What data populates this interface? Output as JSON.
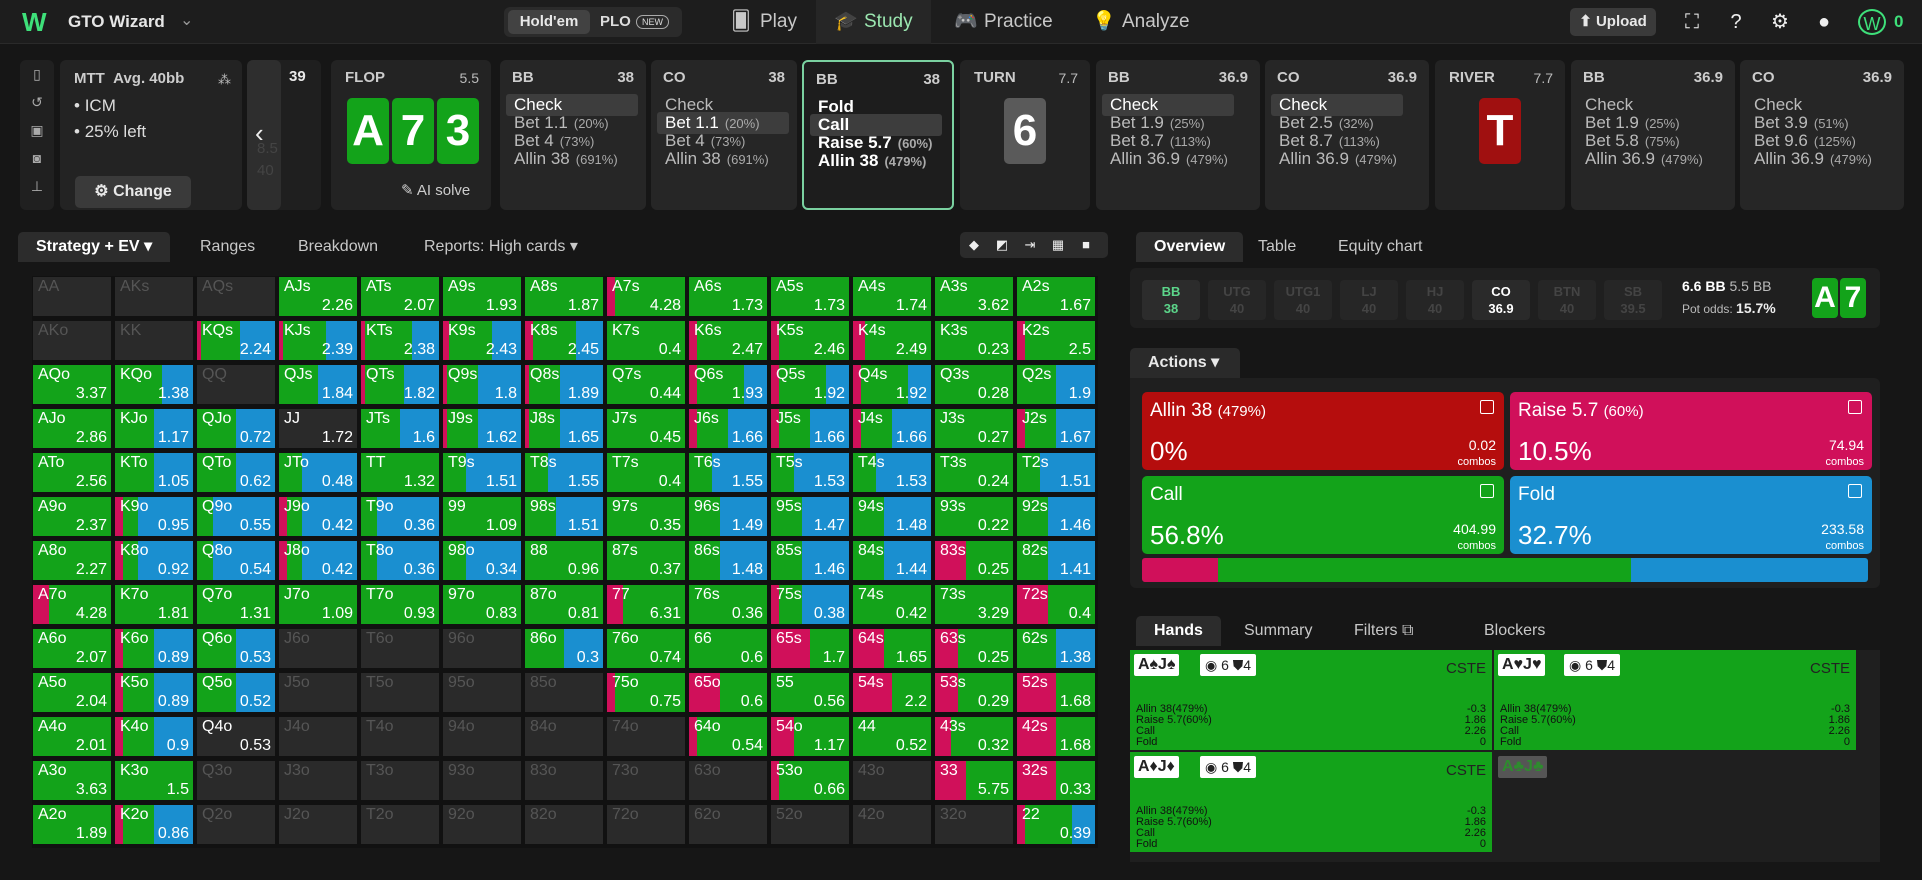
{
  "app": {
    "name": "GTO Wizard"
  },
  "game_toggle": {
    "on": "Hold'em",
    "off": "PLO",
    "badge": "NEW"
  },
  "nav": [
    {
      "label": "Play"
    },
    {
      "label": "Study"
    },
    {
      "label": "Practice"
    },
    {
      "label": "Analyze"
    }
  ],
  "toolbar": {
    "upload": "Upload",
    "coins": "0"
  },
  "format": {
    "title": "MTT",
    "avg": "Avg. 40bb",
    "items": [
      "ICM",
      "25% left"
    ],
    "change": "Change"
  },
  "slider": {
    "top": "39",
    "mid": "8.5",
    "bot": "40"
  },
  "flop": {
    "name": "FLOP",
    "pot": "5.5",
    "cards": [
      "A",
      "7",
      "3"
    ],
    "ai": "AI solve"
  },
  "turn": {
    "name": "TURN",
    "pot": "7.7",
    "card": "6"
  },
  "river": {
    "name": "RIVER",
    "pot": "7.7",
    "card": "T"
  },
  "action_cols": [
    {
      "pos": "BB",
      "stack": "38",
      "lines": [
        {
          "t": "Check",
          "p": ""
        },
        {
          "t": "Bet 1.1",
          "p": "(20%)"
        },
        {
          "t": "Bet 4",
          "p": "(73%)"
        },
        {
          "t": "Allin 38",
          "p": "(691%)"
        }
      ]
    },
    {
      "pos": "CO",
      "stack": "38",
      "lines": [
        {
          "t": "Check",
          "p": ""
        },
        {
          "t": "Bet 1.1",
          "p": "(20%)"
        },
        {
          "t": "Bet 4",
          "p": "(73%)"
        },
        {
          "t": "Allin 38",
          "p": "(691%)"
        }
      ]
    },
    {
      "pos": "BB",
      "stack": "38",
      "lines": [
        {
          "t": "Fold",
          "p": ""
        },
        {
          "t": "Call",
          "p": ""
        },
        {
          "t": "Raise 5.7",
          "p": "(60%)"
        },
        {
          "t": "Allin 38",
          "p": "(479%)"
        }
      ]
    },
    {
      "pos": "BB",
      "stack": "36.9",
      "lines": [
        {
          "t": "Check",
          "p": ""
        },
        {
          "t": "Bet 1.9",
          "p": "(25%)"
        },
        {
          "t": "Bet 8.7",
          "p": "(113%)"
        },
        {
          "t": "Allin 36.9",
          "p": "(479%)"
        }
      ]
    },
    {
      "pos": "CO",
      "stack": "36.9",
      "lines": [
        {
          "t": "Check",
          "p": ""
        },
        {
          "t": "Bet 2.5",
          "p": "(32%)"
        },
        {
          "t": "Bet 8.7",
          "p": "(113%)"
        },
        {
          "t": "Allin 36.9",
          "p": "(479%)"
        }
      ]
    },
    {
      "pos": "BB",
      "stack": "36.9",
      "lines": [
        {
          "t": "Check",
          "p": ""
        },
        {
          "t": "Bet 1.9",
          "p": "(25%)"
        },
        {
          "t": "Bet 5.8",
          "p": "(75%)"
        },
        {
          "t": "Allin 36.9",
          "p": "(479%)"
        }
      ]
    },
    {
      "pos": "CO",
      "stack": "36.9",
      "lines": [
        {
          "t": "Check",
          "p": ""
        },
        {
          "t": "Bet 3.9",
          "p": "(51%)"
        },
        {
          "t": "Bet 9.6",
          "p": "(125%)"
        },
        {
          "t": "Allin 36.9",
          "p": "(479%)"
        }
      ]
    }
  ],
  "left_tabs": [
    "Strategy + EV",
    "Ranges",
    "Breakdown",
    "Reports: High cards"
  ],
  "right_tabs": [
    "Overview",
    "Table",
    "Equity chart"
  ],
  "players": [
    {
      "pos": "BB",
      "stack": "38"
    },
    {
      "pos": "UTG",
      "stack": "40"
    },
    {
      "pos": "UTG1",
      "stack": "40"
    },
    {
      "pos": "LJ",
      "stack": "40"
    },
    {
      "pos": "HJ",
      "stack": "40"
    },
    {
      "pos": "CO",
      "stack": "36.9"
    },
    {
      "pos": "BTN",
      "stack": "40"
    },
    {
      "pos": "SB",
      "stack": "39.5"
    }
  ],
  "pot_info": {
    "pot": "6.6 BB",
    "call": "5.5 BB",
    "odds_label": "Pot odds:",
    "odds": "15.7%"
  },
  "hero_cards": [
    "A",
    "7"
  ],
  "actions_label": "Actions",
  "actions": [
    {
      "name": "Allin 38",
      "size": "(479%)",
      "pct": "0%",
      "combos": "0.02",
      "color": "#b50d0d"
    },
    {
      "name": "Raise 5.7",
      "size": "(60%)",
      "pct": "10.5%",
      "combos": "74.94",
      "color": "#d0105a"
    },
    {
      "name": "Call",
      "size": "",
      "pct": "56.8%",
      "combos": "404.99",
      "color": "#13a31a"
    },
    {
      "name": "Fold",
      "size": "",
      "pct": "32.7%",
      "combos": "233.58",
      "color": "#1a8fd0"
    }
  ],
  "combos_word": "combos",
  "freq": [
    0.105,
    0.568,
    0.327
  ],
  "hand_tabs": [
    "Hands",
    "Summary",
    "Filters",
    "Blockers"
  ],
  "hands": [
    {
      "cards": "A♠J♠",
      "b": "6",
      "c": "4",
      "tag": "CSTE",
      "rows": [
        [
          "Allin 38",
          "(479%)",
          "-0.3"
        ],
        [
          "Raise 5.7",
          "(60%)",
          "1.86"
        ],
        [
          "Call",
          "",
          "2.26"
        ],
        [
          "Fold",
          "",
          "0"
        ]
      ]
    },
    {
      "cards": "A♥J♥",
      "b": "6",
      "c": "4",
      "tag": "CSTE",
      "rows": [
        [
          "Allin 38",
          "(479%)",
          "-0.3"
        ],
        [
          "Raise 5.7",
          "(60%)",
          "1.86"
        ],
        [
          "Call",
          "",
          "2.26"
        ],
        [
          "Fold",
          "",
          "0"
        ]
      ]
    },
    {
      "cards": "A♦J♦",
      "b": "6",
      "c": "4",
      "tag": "CSTE",
      "rows": [
        [
          "Allin 38",
          "(479%)",
          "-0.3"
        ],
        [
          "Raise 5.7",
          "(60%)",
          "1.86"
        ],
        [
          "Call",
          "",
          "2.26"
        ],
        [
          "Fold",
          "",
          "0"
        ]
      ]
    },
    {
      "cards": "A♣J♣"
    }
  ],
  "grid": [
    [
      "AA|",
      "AKs|",
      "AQs|",
      "AJs|2.26|c",
      "ATs|2.07|c",
      "A9s|1.93|c",
      "A8s|1.87|c",
      "A7s|4.28|r10c",
      "A6s|1.73|c",
      "A5s|1.73|c",
      "A4s|1.74|c",
      "A3s|3.62|c",
      "A2s|1.67|c"
    ],
    [
      "AKo|",
      "KK|",
      "KQs|2.24|r5c50f",
      "KJs|2.39|r5c55f",
      "KTs|2.38|r5c60f",
      "K9s|2.43|r8c55f",
      "K8s|2.45|r10c55f",
      "K7s|0.4|c",
      "K6s|2.47|r10c",
      "K5s|2.46|r10c",
      "K4s|2.49|r15c",
      "K3s|0.23|c",
      "K2s|2.5|r10c"
    ],
    [
      "AQo|3.37|c",
      "KQo|1.38|c60f",
      "QQ|",
      "QJs|1.84|c50f",
      "QTs|1.82|r5c50f",
      "Q9s|1.8|r5c40f",
      "Q8s|1.89|r5c40f",
      "Q7s|0.44|c",
      "Q6s|1.93|r10c60f",
      "Q5s|1.92|r10c60f",
      "Q4s|1.92|r10c60f",
      "Q3s|0.28|c",
      "Q2s|1.9|c50f"
    ],
    [
      "AJo|2.86|c",
      "KJo|1.17|c50f",
      "QJo|0.72|c50f",
      "JJ|1.72|d",
      "JTs|1.6|c50f",
      "J9s|1.62|r5c40f",
      "J8s|1.65|r5c40f",
      "J7s|0.45|c",
      "J6s|1.66|r10c40f",
      "J5s|1.66|r10c40f",
      "J4s|1.66|r10c40f",
      "J3s|0.27|c",
      "J2s|1.67|r10c40f"
    ],
    [
      "ATo|2.56|c",
      "KTo|1.05|c50f",
      "QTo|0.62|c50f",
      "JTo|0.48|c30f",
      "TT|1.32|c",
      "T9s|1.51|c30f",
      "T8s|1.55|c30f",
      "T7s|0.4|c",
      "T6s|1.55|c30f",
      "T5s|1.53|c30f",
      "T4s|1.53|c30f",
      "T3s|0.24|c",
      "T2s|1.51|c30f"
    ],
    [
      "A9o|2.37|c",
      "K9o|0.95|r10c20f",
      "Q9o|0.55|c20f",
      "J9o|0.42|r10c20f",
      "T9o|0.36|c20f",
      "99|1.09|c",
      "98s|1.51|c40f",
      "97s|0.35|c",
      "96s|1.49|c40f",
      "95s|1.47|c40f",
      "94s|1.48|c40f",
      "93s|0.22|c",
      "92s|1.46|c40f"
    ],
    [
      "A8o|2.27|c",
      "K8o|0.92|r10c20f",
      "Q8o|0.54|c20f",
      "J8o|0.42|r10c20f",
      "T8o|0.36|c20f",
      "98o|0.34|c30f",
      "88|0.96|c",
      "87s|0.37|c",
      "86s|1.48|c40f",
      "85s|1.46|c40f",
      "84s|1.44|c40f",
      "83s|0.25|r40c",
      "82s|1.41|c40f"
    ],
    [
      "A7o|4.28|r20c",
      "K7o|1.81|c",
      "Q7o|1.31|c",
      "J7o|1.09|c",
      "T7o|0.93|c",
      "97o|0.83|c",
      "87o|0.81|c",
      "77|6.31|r20c",
      "76s|0.36|d20c",
      "75s|0.38|r10c30f",
      "74s|0.42|c",
      "73s|3.29|c",
      "72s|0.4|r40c"
    ],
    [
      "A6o|2.07|c",
      "K6o|0.89|r10c40f",
      "Q6o|0.53|c50f",
      "J6o|",
      "T6o|",
      "96o|",
      "86o|0.3|c50f",
      "76o|0.74|c",
      "66|0.6|c",
      "65s|1.7|r50c",
      "64s|1.65|r40c",
      "63s|0.25|r30c",
      "62s|1.38|c50f"
    ],
    [
      "A5o|2.04|c",
      "K5o|0.89|r10c40f",
      "Q5o|0.52|c50f",
      "J5o|",
      "T5o|",
      "95o|",
      "85o|",
      "75o|0.75|r10c",
      "65o|0.6|r40c",
      "55|0.56|c",
      "54s|2.2|r50c",
      "53s|0.29|r30c",
      "52s|1.68|r50c"
    ],
    [
      "A4o|2.01|c",
      "K4o|0.9|r10c40f",
      "Q4o|0.53|d",
      "J4o|",
      "T4o|",
      "94o|",
      "84o|",
      "74o|",
      "64o|0.54|r10c",
      "54o|1.17|r30c",
      "44|0.52|c",
      "43s|0.32|r20c",
      "42s|1.68|r50c"
    ],
    [
      "A3o|3.63|c",
      "K3o|1.5|c",
      "Q3o|",
      "J3o|",
      "T3o|",
      "93o|",
      "83o|",
      "73o|",
      "63o|",
      "53o|0.66|r10c",
      "43o|",
      "33|5.75|r40c",
      "32s|0.33|r50c"
    ],
    [
      "A2o|1.89|c",
      "K2o|0.86|r10c40f",
      "Q2o|",
      "J2o|",
      "T2o|",
      "92o|",
      "82o|",
      "72o|",
      "62o|",
      "52o|",
      "42o|",
      "32o|",
      "22|0.39|r10c60f"
    ]
  ]
}
